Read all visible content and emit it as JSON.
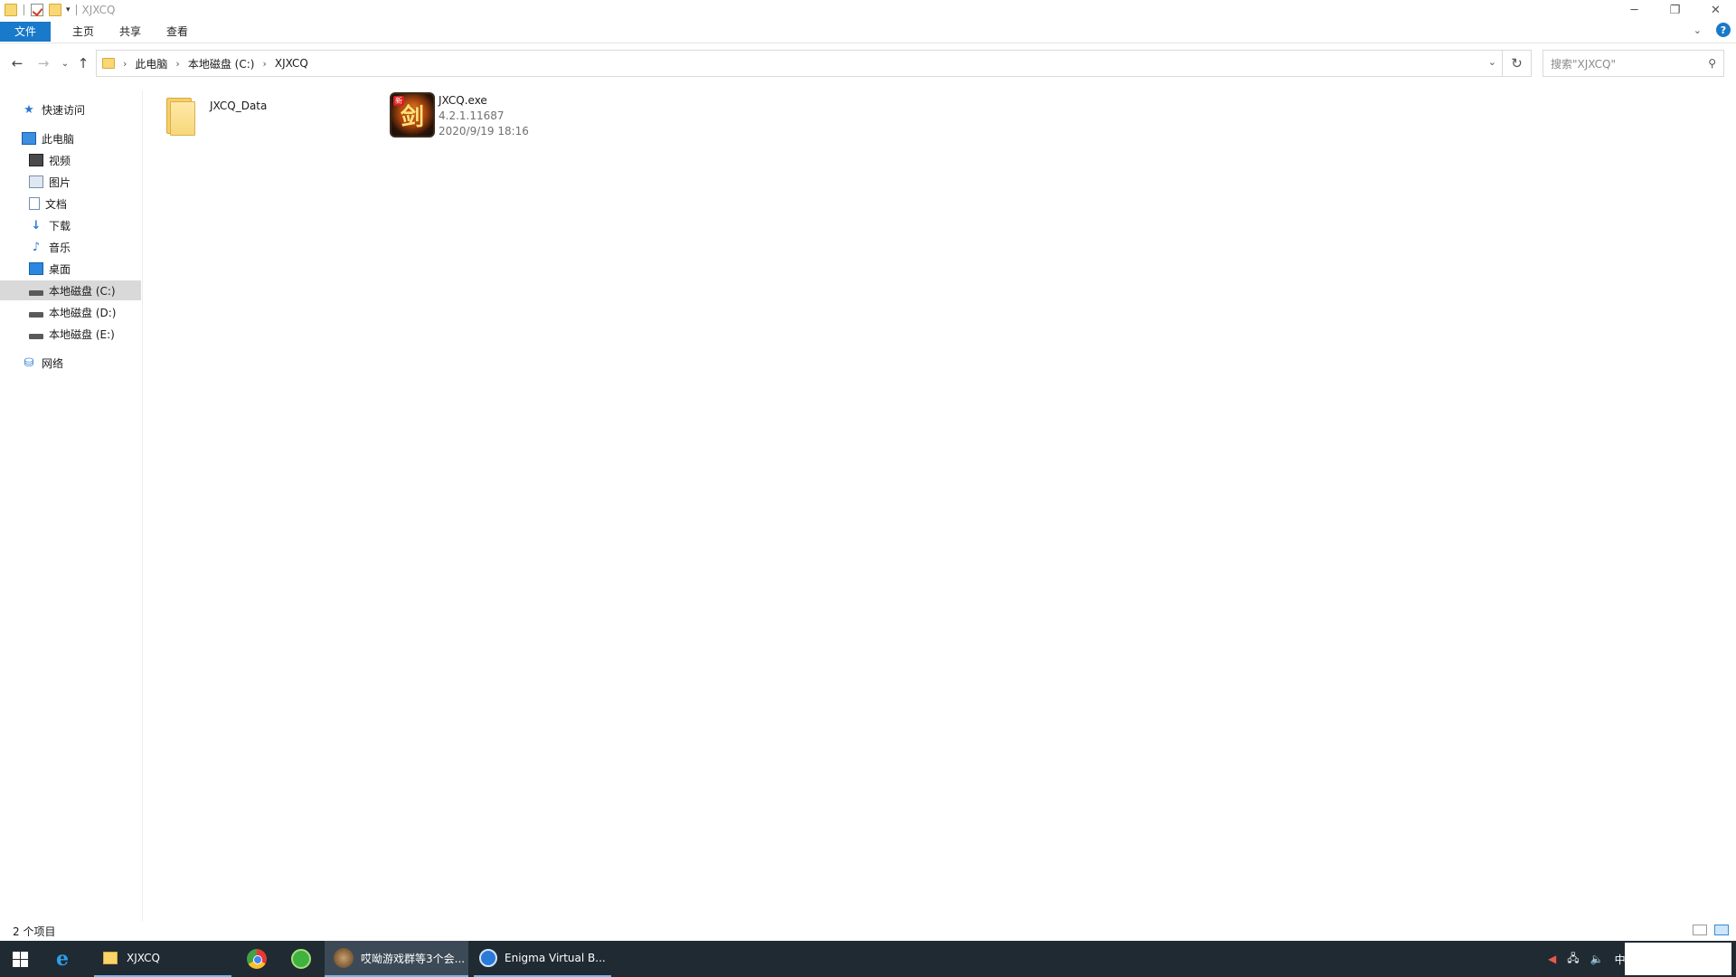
{
  "window": {
    "title": "XJXCQ",
    "controls": {
      "minimize": "─",
      "restore": "❐",
      "close": "✕"
    }
  },
  "ribbon": {
    "tabs": [
      "文件",
      "主页",
      "共享",
      "查看"
    ],
    "expand_icon": "chevron-down-icon",
    "help": "?"
  },
  "address": {
    "breadcrumbs": [
      "此电脑",
      "本地磁盘 (C:)",
      "XJXCQ"
    ],
    "search_placeholder": "搜索\"XJXCQ\""
  },
  "navpane": {
    "quick_access": "快速访问",
    "this_pc": "此电脑",
    "items": [
      "视频",
      "图片",
      "文档",
      "下载",
      "音乐",
      "桌面",
      "本地磁盘 (C:)",
      "本地磁盘 (D:)",
      "本地磁盘 (E:)"
    ],
    "selected": "本地磁盘 (C:)",
    "network": "网络"
  },
  "files": [
    {
      "name": "JXCQ_Data",
      "type": "folder"
    },
    {
      "name": "JXCQ.exe",
      "version": "4.2.1.11687",
      "date": "2020/9/19 18:16",
      "type": "exe",
      "icon_glyph": "剑",
      "icon_badge": "新"
    }
  ],
  "status": {
    "count_text": "2 个项目"
  },
  "taskbar": {
    "explorer_label": "XJXCQ",
    "chat_label": "哎呦游戏群等3个会...",
    "enigma_label": "Enigma Virtual B...",
    "ime": "中"
  },
  "colors": {
    "accent": "#1979ca",
    "taskbar": "#1f2a33",
    "selection": "#d9d9d9"
  }
}
